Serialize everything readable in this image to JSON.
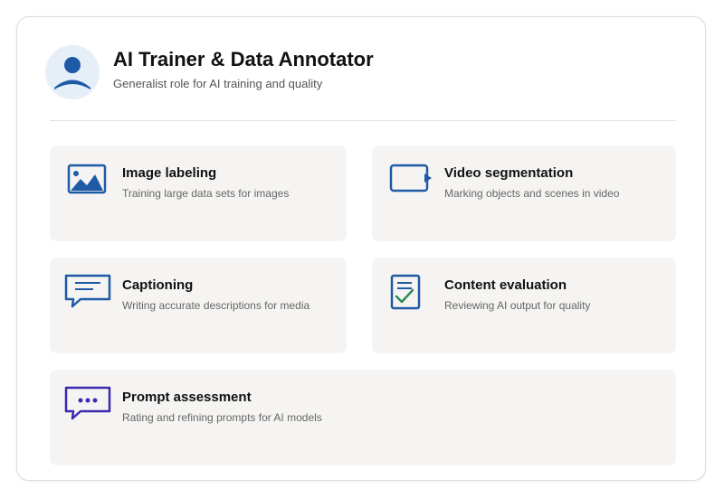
{
  "header": {
    "title": "AI Trainer & Data Annotator",
    "subtitle": "Generalist role for AI training and quality",
    "avatar_icon": "user-avatar-icon"
  },
  "colors": {
    "primary_blue": "#1f5aa6",
    "check_green": "#2e8b57",
    "purple": "#3b2bb0",
    "tile_bg": "#f5f4f2"
  },
  "tasks": [
    {
      "title": "Image labeling",
      "description": "Training large data sets for images",
      "icon": "image-icon"
    },
    {
      "title": "Video segmentation",
      "description": "Marking objects and scenes in video",
      "icon": "video-icon"
    },
    {
      "title": "Captioning",
      "description": "Writing accurate descriptions for media",
      "icon": "speech-bubble-icon"
    },
    {
      "title": "Content evaluation",
      "description": "Reviewing AI output for quality",
      "icon": "checklist-icon"
    },
    {
      "title": "Prompt assessment",
      "description": "Rating and refining prompts for AI models",
      "icon": "chat-dots-icon"
    }
  ]
}
